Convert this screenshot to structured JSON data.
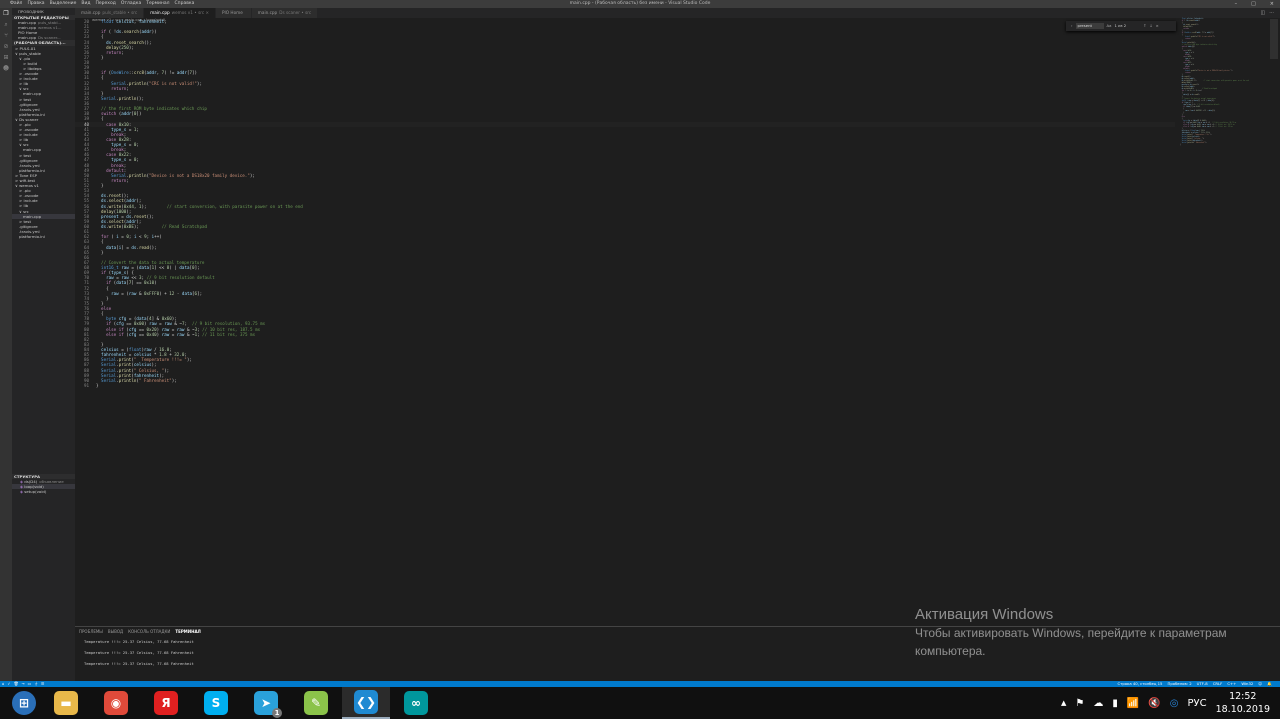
{
  "window": {
    "title": "main.cpp - (Рабочая область) без имени - Visual Studio Code",
    "menu": [
      "Файл",
      "Правка",
      "Выделение",
      "Вид",
      "Переход",
      "Отладка",
      "Терминал",
      "Справка"
    ]
  },
  "activity_icons": [
    "files-icon",
    "search-icon",
    "source-control-icon",
    "debug-icon",
    "extensions-icon",
    "platformio-icon"
  ],
  "sidebar": {
    "header": "ПРОВОДНИК",
    "open_editors_title": "ОТКРЫТЫЕ РЕДАКТОРЫ",
    "open_editors": [
      {
        "name": "main.cpp",
        "hint": "puls_stabl..."
      },
      {
        "name": "main.cpp",
        "hint": "wemos v1..."
      },
      {
        "name": "PIO Home",
        "hint": ""
      },
      {
        "name": "main.cpp",
        "hint": "Ds scaner..."
      }
    ],
    "workspace_title": "(РАБОЧАЯ ОБЛАСТЬ)...",
    "tree": [
      {
        "d": 0,
        "t": "> PULS-01"
      },
      {
        "d": 0,
        "t": "∨ puls_stable"
      },
      {
        "d": 1,
        "t": "∨ .pio"
      },
      {
        "d": 2,
        "t": "> build"
      },
      {
        "d": 2,
        "t": "> libdeps"
      },
      {
        "d": 1,
        "t": "> .vscode"
      },
      {
        "d": 1,
        "t": "> include"
      },
      {
        "d": 1,
        "t": "> lib"
      },
      {
        "d": 1,
        "t": "∨ src"
      },
      {
        "d": 2,
        "t": "main.cpp"
      },
      {
        "d": 1,
        "t": "> test"
      },
      {
        "d": 1,
        "t": ".gitignore"
      },
      {
        "d": 1,
        "t": ".travis.yml"
      },
      {
        "d": 1,
        "t": "platformio.ini"
      },
      {
        "d": 0,
        "t": "∨ Ds scaner"
      },
      {
        "d": 1,
        "t": "> .pio"
      },
      {
        "d": 1,
        "t": "> .vscode"
      },
      {
        "d": 1,
        "t": "> include"
      },
      {
        "d": 1,
        "t": "> lib"
      },
      {
        "d": 1,
        "t": "∨ src"
      },
      {
        "d": 2,
        "t": "main.cpp"
      },
      {
        "d": 1,
        "t": "> test"
      },
      {
        "d": 1,
        "t": ".gitignore"
      },
      {
        "d": 1,
        "t": ".travis.yml"
      },
      {
        "d": 1,
        "t": "platformio.ini"
      },
      {
        "d": 0,
        "t": "> Tone ESP"
      },
      {
        "d": 0,
        "t": "> wifi-test"
      },
      {
        "d": 0,
        "t": "∨ wemos v1"
      },
      {
        "d": 1,
        "t": "> .pio"
      },
      {
        "d": 1,
        "t": "> .vscode"
      },
      {
        "d": 1,
        "t": "> include"
      },
      {
        "d": 1,
        "t": "> lib"
      },
      {
        "d": 1,
        "t": "∨ src"
      },
      {
        "d": 2,
        "t": "main.cpp",
        "sel": true
      },
      {
        "d": 1,
        "t": "> test"
      },
      {
        "d": 1,
        "t": ".gitignore"
      },
      {
        "d": 1,
        "t": ".travis.yml"
      },
      {
        "d": 1,
        "t": "platformio.ini"
      }
    ],
    "outline_title": "СТРУКТУРА",
    "outline": [
      {
        "name": "ds(D4)",
        "hint": "объявление"
      },
      {
        "name": "loop(void)",
        "sel": true
      },
      {
        "name": "setup(void)"
      }
    ]
  },
  "tabs": [
    {
      "name": "main.cpp",
      "hint": "puls_stable • src"
    },
    {
      "name": "main.cpp",
      "hint": "wemos v1 • src ×",
      "active": true
    },
    {
      "name": "PIO Home",
      "hint": ""
    },
    {
      "name": "main.cpp",
      "hint": "Ds scaner • src"
    }
  ],
  "breadcrumb": "wemos v1 › src › main.cpp › loop(void)",
  "find": {
    "value": "present",
    "count": "1 из 2"
  },
  "editor": {
    "first_line": 20,
    "current_line": 40,
    "lines": [
      "  float celsius, fahrenheit;",
      "",
      "  if ( !ds.search(addr))",
      "  {",
      "    ds.reset_search();",
      "    delay(250);",
      "    return;",
      "  }",
      "",
      "",
      "  if (OneWire::crc8(addr, 7) != addr[7])",
      "  {",
      "      Serial.println(\"CRC is not valid!\");",
      "      return;",
      "  }",
      "  Serial.println();",
      "",
      "  // the first ROM byte indicates which chip",
      "  switch (addr[0])",
      "  {",
      "    case 0x10:",
      "      type_s = 1;",
      "      break;",
      "    case 0x28:",
      "      type_s = 0;",
      "      break;",
      "    case 0x22:",
      "      type_s = 0;",
      "      break;",
      "    default:",
      "      Serial.println(\"Device is not a DS18x20 family device.\");",
      "      return;",
      "  }",
      "",
      "  ds.reset();",
      "  ds.select(addr);",
      "  ds.write(0x44, 1);        // start conversion, with parasite power on at the end",
      "  delay(1000);",
      "  present = ds.reset();",
      "  ds.select(addr);",
      "  ds.write(0xBE);         // Read Scratchpad",
      "",
      "  for ( i = 0; i < 9; i++)",
      "  {",
      "    data[i] = ds.read();",
      "  }",
      "",
      "  // Convert the data to actual temperature",
      "  int16_t raw = (data[1] << 8) | data[0];",
      "  if (type_s) {",
      "    raw = raw << 3; // 9 bit resolution default",
      "    if (data[7] == 0x10)",
      "    {",
      "      raw = (raw & 0xFFF0) + 12 - data[6];",
      "    }",
      "  }",
      "  else",
      "  {",
      "    byte cfg = (data[4] & 0x60);",
      "    if (cfg == 0x00) raw = raw & ~7;  // 9 bit resolution, 93.75 ms",
      "    else if (cfg == 0x20) raw = raw & ~3; // 10 bit res, 187.5 ms",
      "    else if (cfg == 0x40) raw = raw & ~1; // 11 bit res, 375 ms",
      "",
      "  }",
      "  celsius = (float)raw / 16.0;",
      "  fahrenheit = celsius * 1.8 + 32.0;",
      "  Serial.print(\"  Temperature !!!= \");",
      "  Serial.print(celsius);",
      "  Serial.print(\" Celsius, \");",
      "  Serial.print(fahrenheit);",
      "  Serial.println(\" Fahrenheit\");",
      "}"
    ]
  },
  "panel": {
    "tabs": [
      "ПРОБЛЕМЫ",
      "ВЫВОД",
      "КОНСОЛЬ ОТЛАДКИ",
      "ТЕРМИНАЛ"
    ],
    "active_tab": "ТЕРМИНАЛ",
    "terminal": [
      "Temperature !!!= 25.37 Celsius, 77.68 Fahrenheit",
      "Temperature !!!= 25.37 Celsius, 77.68 Fahrenheit",
      "Temperature !!!= 25.37 Celsius, 77.68 Fahrenheit"
    ]
  },
  "status": {
    "left_icons": [
      "home-icon",
      "check-icon",
      "trash-icon",
      "upload-icon",
      "terminal-icon",
      "serial-plug-icon",
      "list-icon"
    ],
    "items": [
      "Строка 40, столбец 15",
      "Пробелов: 2",
      "UTF-8",
      "CRLF",
      "C++",
      "Win32"
    ]
  },
  "watermark": {
    "title": "Активация Windows",
    "line1": "Чтобы активировать Windows, перейдите к параметрам",
    "line2": "компьютера."
  },
  "taskbar": {
    "apps": [
      "start",
      "file-explorer",
      "chrome",
      "yandex-browser",
      "skype",
      "telegram",
      "notepad-plus-plus",
      "vscode",
      "arduino"
    ],
    "active": "vscode",
    "telegram_badge": "1",
    "lang": "РУС",
    "time": "12:52",
    "date": "18.10.2019"
  },
  "colors": {
    "statusbar": "#007acc",
    "editor_bg": "#1e1e1e",
    "sidebar_bg": "#252526",
    "accent": "#007acc"
  }
}
